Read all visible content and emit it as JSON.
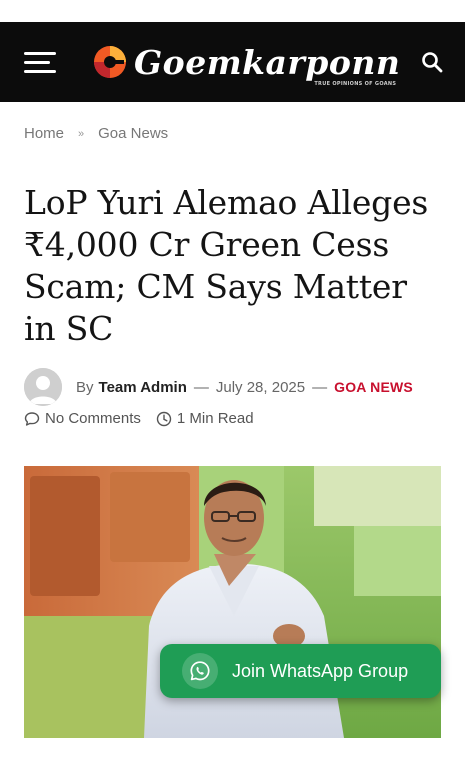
{
  "header": {
    "logo_text": "Goemkarponn",
    "logo_tagline": "TRUE OPINIONS OF GOANS",
    "menu_icon": "hamburger-menu-icon",
    "search_icon": "search-icon",
    "background": "#0c0c0c"
  },
  "breadcrumb": {
    "home": "Home",
    "separator": "»",
    "current": "Goa News"
  },
  "article": {
    "title": "LoP Yuri Alemao Alleges ₹4,000 Cr Green Cess Scam; CM Says Matter in SC",
    "by_label": "By",
    "author": "Team Admin",
    "dash": "—",
    "date": "July 28, 2025",
    "category": "GOA NEWS",
    "category_color": "#c8102e",
    "comments": "No Comments",
    "read_time": "1 Min Read"
  },
  "whatsapp": {
    "label": "Join WhatsApp Group",
    "icon": "whatsapp-icon",
    "color": "#1f9d55"
  }
}
